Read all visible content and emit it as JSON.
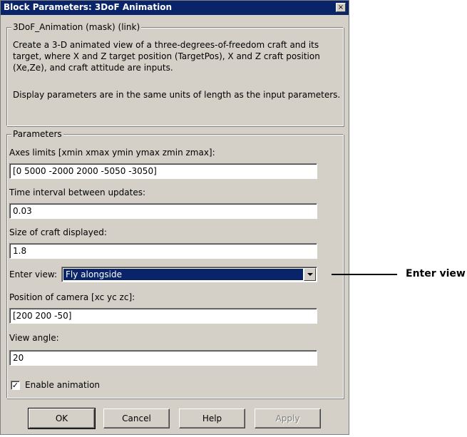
{
  "window": {
    "title": "Block Parameters: 3DoF Animation",
    "close_symbol": "×"
  },
  "description_group": {
    "legend": "3DoF_Animation (mask) (link)",
    "text1": "Create a 3-D animated view of a three-degrees-of-freedom craft and its target, where X and Z target position (TargetPos), X and Z craft position (Xe,Ze), and craft attitude are inputs.",
    "text2": "Display parameters are in the same units of length as the input parameters."
  },
  "parameters": {
    "legend": "Parameters",
    "axes_limits": {
      "label": "Axes limits [xmin xmax ymin ymax zmin zmax]:",
      "value": "[0 5000 -2000 2000 -5050 -3050]"
    },
    "time_interval": {
      "label": "Time interval between updates:",
      "value": "0.03"
    },
    "craft_size": {
      "label": "Size of craft displayed:",
      "value": "1.8"
    },
    "enter_view": {
      "label": "Enter view:",
      "selected": "Fly alongside"
    },
    "camera_position": {
      "label": "Position of camera [xc yc zc]:",
      "value": "[200 200 -50]"
    },
    "view_angle": {
      "label": "View angle:",
      "value": "20"
    },
    "enable_animation": {
      "label": "Enable animation",
      "checked": true,
      "check_symbol": "✓"
    }
  },
  "buttons": {
    "ok": "OK",
    "cancel": "Cancel",
    "help": "Help",
    "apply": "Apply"
  },
  "callout": {
    "label": "Enter view"
  },
  "colors": {
    "title_bar": "#0a246a",
    "dialog_face": "#d4d0c8",
    "selection": "#0a246a"
  }
}
